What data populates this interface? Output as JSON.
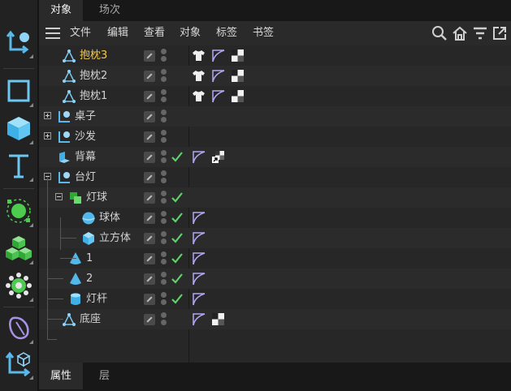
{
  "top_tabs": [
    {
      "label": "对象",
      "active": true
    },
    {
      "label": "场次",
      "active": false
    }
  ],
  "menu": [
    "文件",
    "编辑",
    "查看",
    "对象",
    "标签",
    "书签"
  ],
  "toolbar_icons": [
    "null-object-icon",
    "cube-outline-icon",
    "cube-icon",
    "text-icon",
    "light-icon",
    "cloner-icon",
    "gear-icon",
    "deformer-icon",
    "null-cube-icon"
  ],
  "objects": [
    {
      "name": "抱枕3",
      "icon": "pillow-icon",
      "highlight": true,
      "check": false,
      "tags": [
        "shirt",
        "phong",
        "material"
      ]
    },
    {
      "name": "抱枕2",
      "icon": "pillow-icon",
      "highlight": false,
      "check": false,
      "tags": [
        "shirt",
        "phong",
        "material"
      ]
    },
    {
      "name": "抱枕1",
      "icon": "pillow-icon",
      "highlight": false,
      "check": false,
      "tags": [
        "shirt",
        "phong",
        "material"
      ]
    },
    {
      "name": "桌子",
      "icon": "null-icon",
      "highlight": false,
      "check": false,
      "tags": []
    },
    {
      "name": "沙发",
      "icon": "null-icon",
      "highlight": false,
      "check": false,
      "tags": []
    },
    {
      "name": "背幕",
      "icon": "background-icon",
      "highlight": false,
      "check": true,
      "tags": [
        "phong",
        "material-link"
      ]
    },
    {
      "name": "台灯",
      "icon": "null-icon",
      "highlight": false,
      "check": false,
      "tags": []
    },
    {
      "name": "灯球",
      "icon": "boole-icon",
      "highlight": false,
      "check": true,
      "tags": []
    },
    {
      "name": "球体",
      "icon": "sphere-icon",
      "highlight": false,
      "check": true,
      "tags": [
        "phong"
      ]
    },
    {
      "name": "立方体",
      "icon": "cube-icon",
      "highlight": false,
      "check": true,
      "tags": [
        "phong"
      ]
    },
    {
      "name": "1",
      "icon": "cone-icon",
      "highlight": false,
      "check": true,
      "tags": [
        "phong"
      ]
    },
    {
      "name": "2",
      "icon": "cone-icon",
      "highlight": false,
      "check": true,
      "tags": [
        "phong"
      ]
    },
    {
      "name": "灯杆",
      "icon": "cylinder-icon",
      "highlight": false,
      "check": true,
      "tags": [
        "phong"
      ]
    },
    {
      "name": "底座",
      "icon": "pillow-icon",
      "highlight": false,
      "check": false,
      "tags": [
        "phong",
        "material"
      ]
    }
  ],
  "bottom_tabs": [
    {
      "label": "属性",
      "active": true
    },
    {
      "label": "层",
      "active": false
    }
  ],
  "colors": {
    "highlight": "#f5c84c",
    "check": "#5fd06a",
    "accent_blue": "#52b8ea",
    "accent_green": "#3ec14b"
  }
}
